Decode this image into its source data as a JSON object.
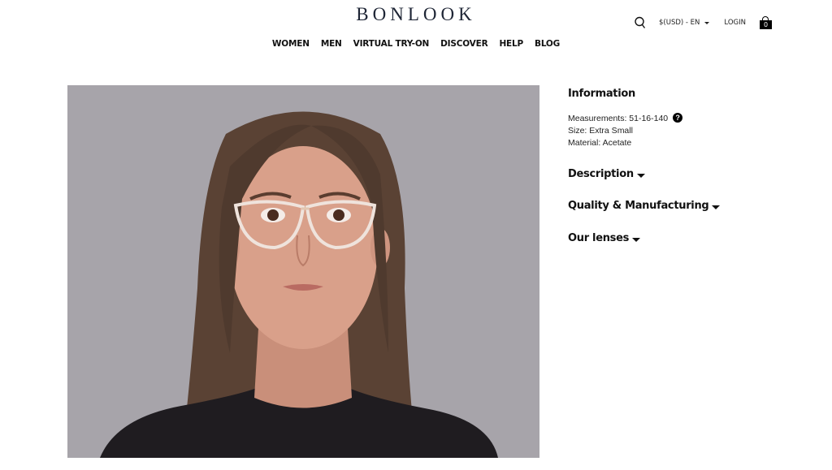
{
  "header": {
    "logo": "BONLOOK",
    "nav": [
      "WOMEN",
      "MEN",
      "VIRTUAL TRY-ON",
      "DISCOVER",
      "HELP",
      "BLOG"
    ],
    "currency": "$(USD) - EN",
    "login": "LOGIN",
    "cart_count": "0"
  },
  "product": {
    "photo_alt": "Woman wearing clear round acetate eyeglasses",
    "colors": {
      "photo_background": "#a7a4aa",
      "hair": "#5a4234",
      "skin": "#d9a08a",
      "shirt": "#1f1c20"
    }
  },
  "info": {
    "title": "Information",
    "measurements": "Measurements: 51-16-140",
    "help_glyph": "?",
    "size": "Size: Extra Small",
    "material": "Material: Acetate",
    "sections": [
      "Description",
      "Quality & Manufacturing",
      "Our lenses"
    ]
  }
}
